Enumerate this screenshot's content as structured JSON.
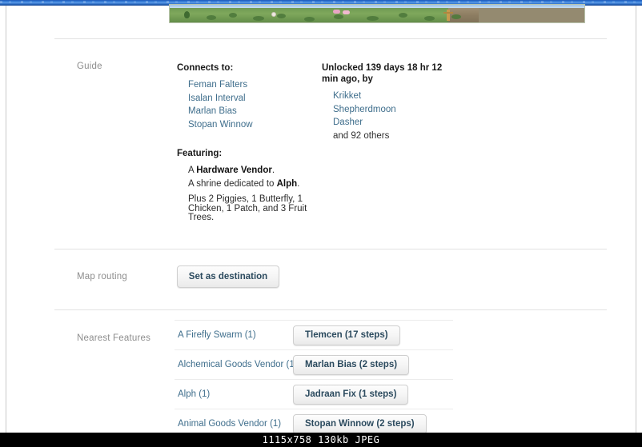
{
  "window": {
    "titlebar_color": "#2f77d4"
  },
  "hero": {
    "alt": "pixel art landscape banner"
  },
  "guide": {
    "label": "Guide",
    "connects": {
      "heading": "Connects to:",
      "items": [
        "Feman Falters",
        "Isalan Interval",
        "Marlan Bias",
        "Stopan Winnow"
      ]
    },
    "unlocked": {
      "heading": "Unlocked 139 days 18 hr 12 min ago, by",
      "users": [
        "Krikket",
        "Shepherdmoon",
        "Dasher"
      ],
      "others": "and 92 others"
    },
    "featuring": {
      "heading": "Featuring:",
      "lines": [
        {
          "prefix": "A ",
          "bold": "Hardware Vendor",
          "suffix": "."
        },
        {
          "prefix": "A shrine dedicated to ",
          "bold": "Alph",
          "suffix": "."
        }
      ],
      "plus_text": "Plus 2 Piggies, 1 Butterfly, 1 Chicken, 1 Patch, and 3 Fruit Trees."
    }
  },
  "map_routing": {
    "label": "Map routing",
    "set_destination_label": "Set as destination"
  },
  "nearest_features": {
    "label": "Nearest Features",
    "rows": [
      {
        "name": "A Firefly Swarm (1)",
        "destination": "Tlemcen (17 steps)"
      },
      {
        "name": "Alchemical Goods Vendor (1)",
        "destination": "Marlan Bias (2 steps)"
      },
      {
        "name": "Alph (1)",
        "destination": "Jadraan Fix (1 steps)"
      },
      {
        "name": "Animal Goods Vendor (1)",
        "destination": "Stopan Winnow (2 steps)"
      }
    ]
  },
  "statusbar": {
    "text": "1115x758  130kb  JPEG"
  },
  "colors": {
    "link": "#3f6e8c",
    "label": "#8d8d8d",
    "button_text": "#2b4a5e",
    "divider": "#e2e2e2"
  }
}
